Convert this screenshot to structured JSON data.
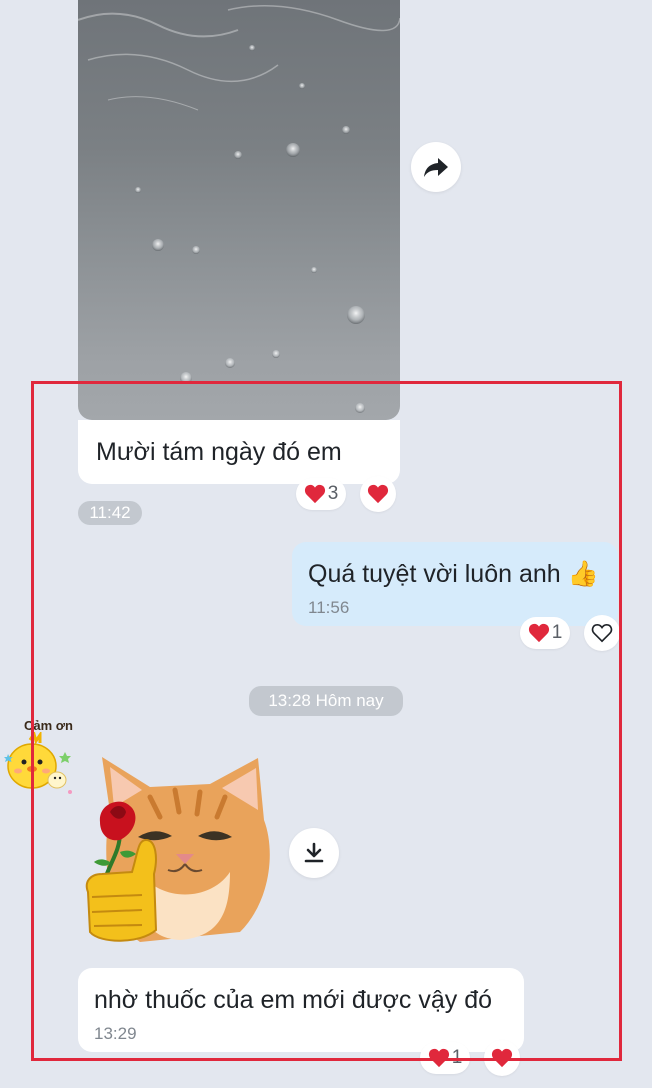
{
  "messages": {
    "photo_caption": "Mười tám ngày đó em",
    "photo_reaction_count": "3",
    "photo_time": "11:42",
    "sent_text": "Quá tuyệt vời luôn anh",
    "sent_emoji": "👍",
    "sent_time": "11:56",
    "sent_reaction_count": "1",
    "date_divider": "13:28 Hôm nay",
    "sticker_label": "Cảm ơn",
    "recv_text": "nhờ thuốc của em mới được vậy đó",
    "recv_time": "13:29",
    "recv_reaction_count": "1"
  },
  "icons": {
    "forward": "forward-arrow-icon",
    "download": "download-icon",
    "heart": "heart-icon",
    "heart_outline": "heart-outline-icon"
  },
  "colors": {
    "background": "#e3e7ef",
    "sent_bubble": "#d6ebfb",
    "received_bubble": "#ffffff",
    "heart": "#e0283c",
    "highlight": "#e0283c"
  }
}
